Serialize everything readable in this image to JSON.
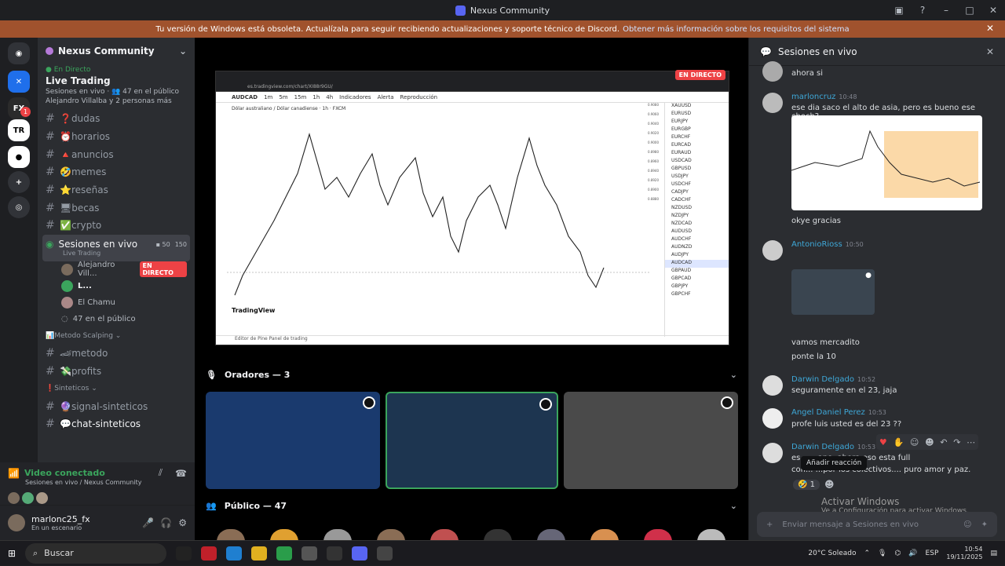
{
  "window": {
    "title": "Nexus Community"
  },
  "banner": {
    "text": "Tu versión de Windows está obsoleta. Actualízala para seguir recibiendo actualizaciones y soporte técnico de Discord.",
    "link": "Obtener más información sobre los requisitos del sistema"
  },
  "rail": {
    "badge": "1"
  },
  "server": {
    "name": "Nexus Community"
  },
  "live_box": {
    "status": "En Directo",
    "title": "Live Trading",
    "audience": "Sesiones en vivo · 👥 47 en el público",
    "members": "Alejandro Villalba  y 2 personas más"
  },
  "channels": [
    {
      "name": "❓dudas"
    },
    {
      "name": "⏰horarios"
    },
    {
      "name": "🔺anuncios"
    },
    {
      "name": "🤣memes"
    },
    {
      "name": "⭐reseñas"
    },
    {
      "name": "🖥becas"
    },
    {
      "name": "✅crypto"
    }
  ],
  "voice_channel": {
    "name": "Sesiones en vivo",
    "sub": "Live Trading",
    "count": "50",
    "limit": "150"
  },
  "voice_users": [
    {
      "name": "Alejandro Vill...",
      "badge": "EN DIRECTO"
    },
    {
      "name": "L..."
    },
    {
      "name": "El Chamu"
    },
    {
      "name": "47 en el público"
    }
  ],
  "categories": {
    "scalping": "📊Metodo Scalping",
    "sinteticos": "❗Sinteticos"
  },
  "channels2": [
    {
      "name": "🏎metodo"
    },
    {
      "name": "💸profits"
    },
    {
      "name": "🔮signal-sinteticos"
    },
    {
      "name": "💬chat-sinteticos"
    }
  ],
  "voice_status": {
    "title": "Video conectado",
    "sub": "Sesiones en vivo / Nexus Community"
  },
  "user": {
    "name": "marlonc25_fx",
    "status": "En un escenario"
  },
  "stage": {
    "live": "EN DIRECTO",
    "oradores": "Oradores — 3",
    "publico": "Público — 47"
  },
  "stream": {
    "url": "es.tradingview.com/chart/XI88r9GU/",
    "symbol": "AUDCAD",
    "tools": [
      "1m",
      "5m",
      "15m",
      "1h",
      "4h",
      "Indicadores",
      "Alerta",
      "Reproducción"
    ],
    "pair_title": "Dólar australiano / Dólar canadiense · 1h · FXCM",
    "watermark": "TradingView",
    "footer": "Editor de Pine    Panel de trading",
    "watchlist": [
      "XAUUSD",
      "EURUSD",
      "EURJPY",
      "EURGBP",
      "EURCHF",
      "EURCAD",
      "EURAUD",
      "USDCAD",
      "GBPUSD",
      "USDJPY",
      "USDCHF",
      "CADJPY",
      "CADCHF",
      "NZDUSD",
      "NZDJPY",
      "NZDCAD",
      "AUDUSD",
      "AUDCHF",
      "AUDNZD",
      "AUDJPY",
      "AUDCAD",
      "GBPAUD",
      "GBPCAD",
      "GBPJPY",
      "GBPCHF"
    ],
    "price_axis": [
      "0.9080",
      "0.9060",
      "0.9040",
      "0.9020",
      "0.9000",
      "0.8980",
      "0.8960",
      "0.8940",
      "0.8920",
      "0.8900",
      "0.8880"
    ]
  },
  "chat": {
    "title": "Sesiones en vivo",
    "messages": [
      {
        "name": "",
        "time": "",
        "text": "ahora si"
      },
      {
        "name": "marloncruz",
        "time": "10:48",
        "text": "ese dia saco el alto de asia, pero es bueno ese choch?"
      },
      {
        "name": "",
        "time": "",
        "text": "okye gracias"
      },
      {
        "name": "AntonioRioss",
        "time": "10:50",
        "text": ""
      },
      {
        "name": "",
        "time": "",
        "text": "vamos mercadito"
      },
      {
        "name": "",
        "time": "",
        "text": "ponte la 10"
      },
      {
        "name": "Darwin Delgado",
        "time": "10:52",
        "text": "seguramente en el 23, jaja"
      },
      {
        "name": "Angel Daniel Perez",
        "time": "10:53",
        "text": "profe luis usted es del 23 ??"
      },
      {
        "name": "Darwin Delgado",
        "time": "10:53",
        "text": "es... ...ano, ahora eso esta full"
      },
      {
        "name": "",
        "time": "",
        "text": "con... ...por los colectivos.... puro amor y paz."
      }
    ],
    "reaction_count": "1",
    "tooltip": "Añadir reacción",
    "placeholder": "Enviar mensaje a Sesiones en vivo"
  },
  "activation": {
    "title": "Activar Windows",
    "sub": "Ve a Configuración para activar Windows."
  },
  "taskbar": {
    "search": "Buscar",
    "weather": "20°C  Soleado",
    "lang": "ESP",
    "time": "10:54",
    "date": "19/11/2025"
  }
}
